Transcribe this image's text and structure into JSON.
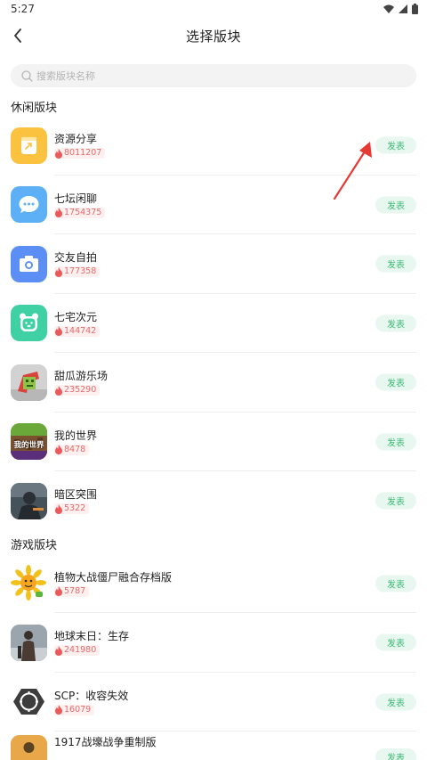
{
  "status_bar": {
    "time": "5:27",
    "icons": [
      "wifi-icon",
      "signal-icon",
      "battery-icon"
    ]
  },
  "nav": {
    "title": "选择版块",
    "back_icon": "chevron-left-icon"
  },
  "search": {
    "placeholder": "搜索版块名称",
    "value": ""
  },
  "colors": {
    "accent_green": "#3cba74",
    "button_bg": "#e8f7ef",
    "heat_red": "#e46a6a",
    "arrow_red": "#e53935"
  },
  "sections": [
    {
      "title": "休闲版块",
      "items": [
        {
          "name": "资源分享",
          "heat": "8011207",
          "button": "发表",
          "icon": "share-icon"
        },
        {
          "name": "七坛闲聊",
          "heat": "1754375",
          "button": "发表",
          "icon": "chat-bubble-icon"
        },
        {
          "name": "交友自拍",
          "heat": "177358",
          "button": "发表",
          "icon": "camera-icon"
        },
        {
          "name": "七宅次元",
          "heat": "144742",
          "button": "发表",
          "icon": "bear-face-icon"
        },
        {
          "name": "甜瓜游乐场",
          "heat": "235290",
          "button": "发表",
          "icon": "melon-playground-game-icon"
        },
        {
          "name": "我的世界",
          "heat": "8478",
          "button": "发表",
          "icon": "minecraft-game-icon",
          "badge_text": "我的世界"
        },
        {
          "name": "暗区突围",
          "heat": "5322",
          "button": "发表",
          "icon": "arena-breakout-game-icon"
        }
      ]
    },
    {
      "title": "游戏版块",
      "items": [
        {
          "name": "植物大战僵尸融合存档版",
          "heat": "5787",
          "button": "发表",
          "icon": "pvz-game-icon"
        },
        {
          "name": "地球末日：生存",
          "heat": "241980",
          "button": "发表",
          "icon": "last-day-on-earth-game-icon"
        },
        {
          "name": "SCP：收容失效",
          "heat": "16079",
          "button": "发表",
          "icon": "scp-logo-icon"
        },
        {
          "name": "1917战壕战争重制版",
          "heat": "",
          "button": "发表",
          "icon": "trench-war-game-icon"
        }
      ]
    }
  ]
}
